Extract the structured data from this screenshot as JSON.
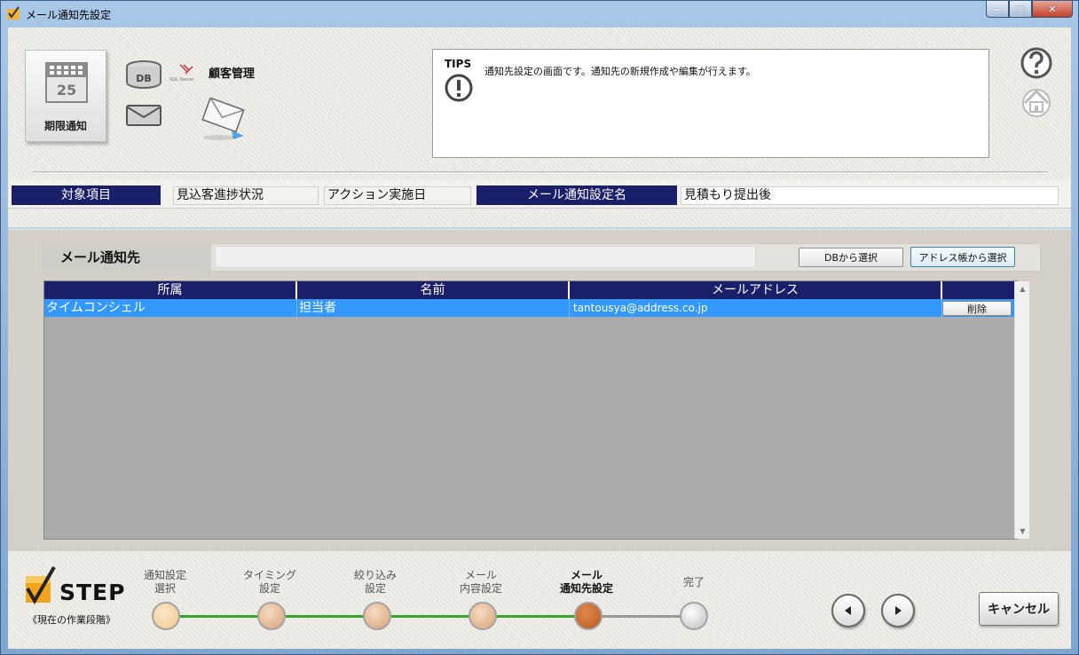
{
  "window": {
    "title": "メール通知先設定"
  },
  "header": {
    "module_label": "期限通知",
    "calendar_day": "25",
    "db_label": "DB",
    "sql_logo_text": "SQL Server",
    "customer_mgmt": "顧客管理",
    "tips_label": "TIPS",
    "tips_text": "通知先設定の画面です。通知先の新規作成や編集が行えます。"
  },
  "target": {
    "label_item": "対象項目",
    "value_item_1": "見込客進捗状況",
    "value_item_2": "アクション実施日",
    "label_setting": "メール通知設定名",
    "value_setting": "見積もり提出後"
  },
  "destination": {
    "label": "メール通知先",
    "db_select": "DBから選択",
    "address_select": "アドレス帳から選択"
  },
  "grid": {
    "headers": [
      "所属",
      "名前",
      "メールアドレス",
      ""
    ],
    "rows": [
      {
        "affiliation": "タイムコンシェル",
        "name": "担当者",
        "email": "tantousya@address.co.jp",
        "delete": "削除"
      }
    ]
  },
  "steps": {
    "logo": "STEP",
    "subtitle": "《現在の作業段階》",
    "items": [
      {
        "line1": "通知設定",
        "line2": "選択"
      },
      {
        "line1": "タイミング",
        "line2": "設定"
      },
      {
        "line1": "絞り込み",
        "line2": "設定"
      },
      {
        "line1": "メール",
        "line2": "内容設定"
      },
      {
        "line1": "メール",
        "line2": "通知先設定"
      },
      {
        "line1": "完了",
        "line2": ""
      }
    ],
    "current_index": 4,
    "cancel": "キャンセル"
  },
  "colors": {
    "header_navy": "#1b1e69",
    "selection_blue": "#3399ff",
    "step_done": "#d7a277",
    "step_current": "#b8581f",
    "progress_green": "#3aa32a"
  }
}
